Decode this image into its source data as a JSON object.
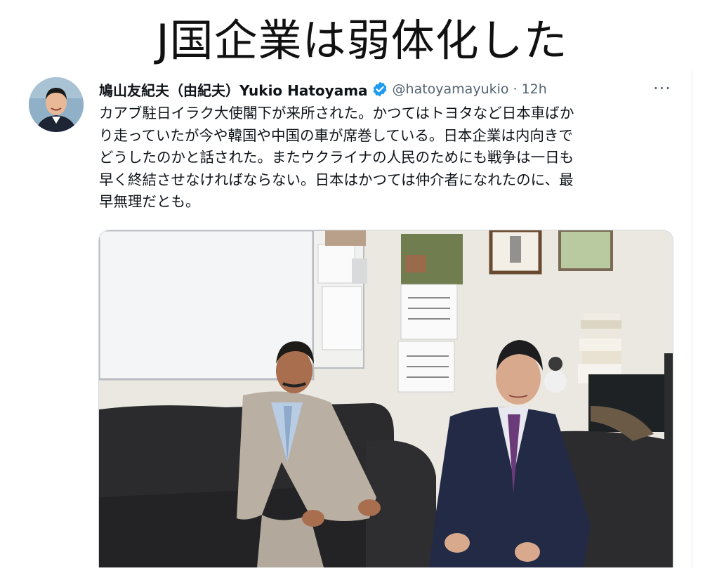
{
  "headline": "J国企業は弱体化した",
  "tweet": {
    "display_name": "鳩山友紀夫（由紀夫）Yukio Hatoyama",
    "handle": "@hatoyamayukio",
    "separator": "·",
    "time": "12h",
    "more_label": "···",
    "text_lines": [
      "カアブ駐日イラク大使閣下が来所された。かつてはトヨタなど日本車ばか",
      "り走っていたが今や韓国や中国の車が席巻している。日本企業は内向きで",
      "どうしたのかと話された。またウクライナの人民のためにも戦争は一日も",
      "早く終結させなければならない。日本はかつては仲介者になれたのに、最",
      "早無理だとも。"
    ],
    "verified_icon": "verified-badge-icon",
    "accent_color": "#1d9bf0"
  },
  "photo": {
    "description_icon": "office-meeting-photo"
  }
}
